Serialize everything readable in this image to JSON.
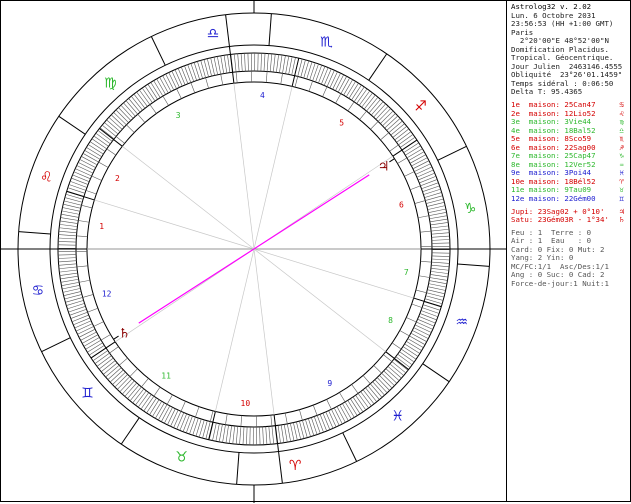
{
  "header": {
    "app_title": "Astrolog32 v. 2.02",
    "lines": [
      "Lun. 6 Octobre 2031",
      "23:56:53 (HH +1:00 GMT)",
      "Paris",
      "  2°20'00\"E 48°52'00\"N",
      "Domification Placidus.",
      "Tropical. Géocentrique.",
      "Jour Julien  2463146.4555",
      "Obliquité  23°26'01.1459\"",
      "Temps sidéral : 0:06:50",
      "Delta T: 95.4365"
    ]
  },
  "houses": [
    {
      "label": "1e  maison:",
      "value": "25Can47",
      "color": "#d40000",
      "symbol": "♋"
    },
    {
      "label": "2e  maison:",
      "value": "12Lio52",
      "color": "#d40000",
      "symbol": "♌"
    },
    {
      "label": "3e  maison:",
      "value": "3Vie44",
      "color": "#2db82d",
      "symbol": "♍"
    },
    {
      "label": "4e  maison:",
      "value": "18Bal52",
      "color": "#2db82d",
      "symbol": "♎"
    },
    {
      "label": "5e  maison:",
      "value": "8Sco59",
      "color": "#d40000",
      "symbol": "♏"
    },
    {
      "label": "6e  maison:",
      "value": "22Sag00",
      "color": "#d40000",
      "symbol": "♐"
    },
    {
      "label": "7e  maison:",
      "value": "25Cap47",
      "color": "#2db82d",
      "symbol": "♑"
    },
    {
      "label": "8e  maison:",
      "value": "12Ver52",
      "color": "#2db82d",
      "symbol": "♒"
    },
    {
      "label": "9e  maison:",
      "value": "3Poi44",
      "color": "#2020d0",
      "symbol": "♓"
    },
    {
      "label": "10e maison:",
      "value": "18Bél52",
      "color": "#d40000",
      "symbol": "♈"
    },
    {
      "label": "11e maison:",
      "value": "9Tau09",
      "color": "#2db82d",
      "symbol": "♉"
    },
    {
      "label": "12e maison:",
      "value": "22Gém00",
      "color": "#2020d0",
      "symbol": "♊"
    }
  ],
  "planets": [
    {
      "label": "Jupi:",
      "value": "23Sag02",
      "extra": " + 0°10'",
      "color": "#d40000",
      "symbol": "♃"
    },
    {
      "label": "Satu:",
      "value": "23Gém03R",
      "extra": " - 1°34'",
      "color": "#d40000",
      "symbol": "♄"
    }
  ],
  "stats": [
    "Feu : 1  Terre : 0",
    "Air : 1  Eau   : 0",
    "Card: 0 Fix: 0 Mut: 2",
    "Yang: 2 Yin: 0",
    "MC/FC:1/1  Asc/Des:1/1",
    "Ang : 0 Suc: 0 Cad: 2",
    "Force-de-jour:1 Nuit:1"
  ],
  "chart": {
    "zodiac_glyphs": [
      "♈",
      "♉",
      "♊",
      "♋",
      "♌",
      "♍",
      "♎",
      "♏",
      "♐",
      "♑",
      "♒",
      "♓"
    ],
    "zodiac_colors": {
      "fire": "#d40000",
      "earth": "#2db82d",
      "air": "#2020d0",
      "water": "#2020d0"
    },
    "house_numbers": [
      "1",
      "2",
      "3",
      "4",
      "5",
      "6",
      "7",
      "8",
      "9",
      "10",
      "11",
      "12"
    ],
    "house_cusps_deg": [
      115.78,
      132.87,
      153.73,
      198.87,
      218.98,
      262.0,
      295.78,
      312.87,
      333.73,
      18.87,
      39.15,
      82.0
    ],
    "asc_deg": 115.78,
    "planet_glyphs": {
      "saturn": "♄",
      "jupiter": "♃"
    },
    "planet_positions_deg": {
      "saturn": 83.05,
      "jupiter": 263.03
    },
    "opposition_color": "#ff00ff"
  }
}
